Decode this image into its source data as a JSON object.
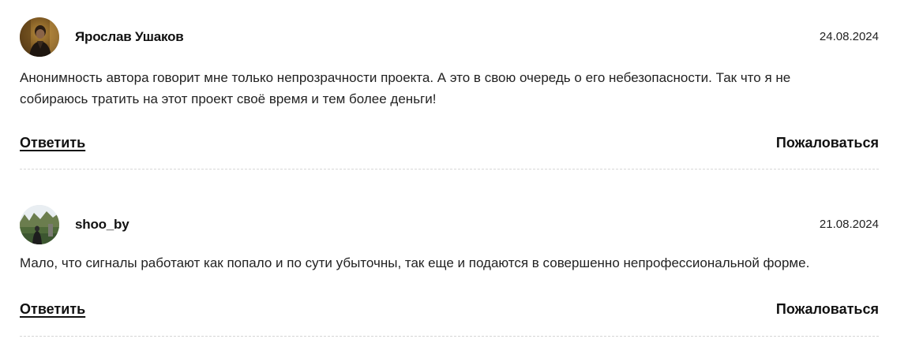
{
  "comments": [
    {
      "author": "Ярослав Ушаков",
      "date": "24.08.2024",
      "text": "Анонимность автора говорит мне только непрозрачности проекта. А это в свою очередь о его небезопасности. Так что я не собираюсь тратить на этот проект своё время и тем более деньги!",
      "reply_label": "Ответить",
      "report_label": "Пожаловаться"
    },
    {
      "author": "shoo_by",
      "date": "21.08.2024",
      "text": "Мало, что сигналы работают как попало и по сути убыточны, так еще и подаются в совершенно непрофессиональной форме.",
      "reply_label": "Ответить",
      "report_label": "Пожаловаться"
    }
  ]
}
